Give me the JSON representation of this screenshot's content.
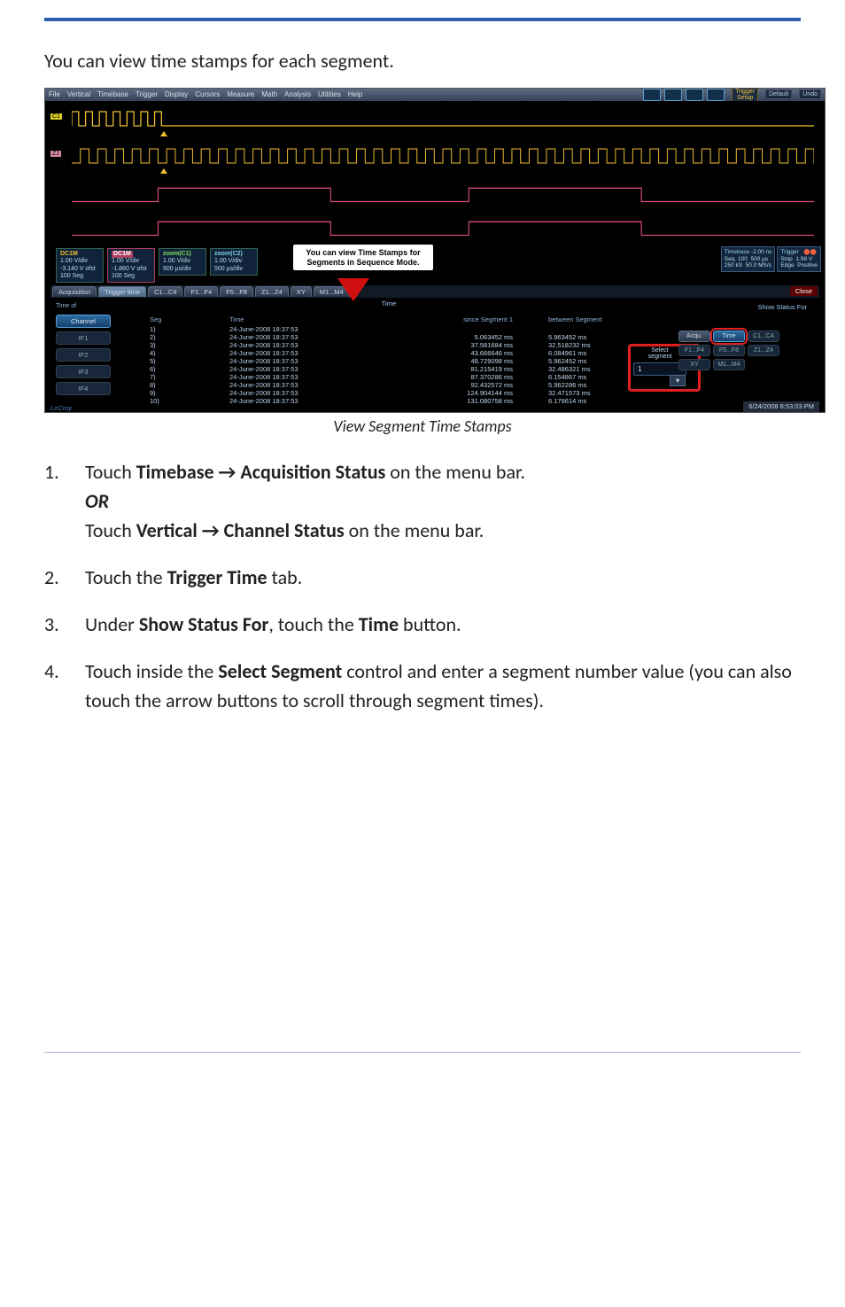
{
  "doc": {
    "intro": "You can view time stamps for each segment.",
    "caption": "View Segment Time Stamps",
    "steps": {
      "s1a_pre": "Touch ",
      "s1a_bold": "Timebase → Acquisition Status",
      "s1a_post": " on the menu bar.",
      "or": "OR",
      "s1b_pre": "Touch ",
      "s1b_bold": "Vertical → Channel Status",
      "s1b_post": " on the menu bar.",
      "s2_pre": "Touch the ",
      "s2_bold": "Trigger Time",
      "s2_post": " tab.",
      "s3_pre": "Under ",
      "s3_bold1": "Show Status For",
      "s3_mid": ", touch the ",
      "s3_bold2": "Time",
      "s3_post": " button.",
      "s4_pre": "Touch inside the ",
      "s4_bold": "Select Segment",
      "s4_post": " control and enter a segment number value (you can also touch the arrow buttons to scroll through segment times)."
    }
  },
  "menu": {
    "items": [
      "File",
      "Vertical",
      "Timebase",
      "Trigger",
      "Display",
      "Cursors",
      "Measure",
      "Math",
      "Analysis",
      "Utilities",
      "Help"
    ],
    "trigger_setup": "Trigger\nSetup",
    "default": "Default",
    "undo": "Undo"
  },
  "channels": {
    "c1": {
      "hdr": "DC1M",
      "l1": "1.00 V/div",
      "l2": "-3.140 V ofst",
      "l3": "100 Seg"
    },
    "c2": {
      "hdr": "DC1M",
      "l1": "1.00 V/div",
      "l2": "-1.880 V ofst",
      "l3": "100 Seg"
    },
    "z1": {
      "hdr": "zoom(C1)",
      "l1": "1.00 V/div",
      "l2": "500 µs/div"
    },
    "z2": {
      "hdr": "zoom(C2)",
      "l1": "1.00 V/div",
      "l2": "500 µs/div"
    }
  },
  "callout": "You can view Time Stamps for Segments in Sequence Mode.",
  "timebase": {
    "tb": {
      "a": "Timebase",
      "b": "-2.00 ns",
      "c": "Seq. 100",
      "d": "500 µs",
      "e": "250 kS",
      "f": "50.0 MS/s"
    },
    "trg": {
      "a": "Trigger",
      "b": "Stop",
      "c": "1.98 V",
      "d": "Edge",
      "e": "Positive"
    }
  },
  "tabs": {
    "acq": "Acquisition",
    "trig": "Trigger time",
    "c14": "C1...C4",
    "f14": "F1...F4",
    "f58": "F5...F8",
    "z14": "Z1...Z4",
    "xy": "XY",
    "m14": "M1...M4",
    "close": "Close"
  },
  "panel": {
    "title": "Time",
    "time_of": "Time of",
    "channel": "Channel",
    "if_labels": [
      "IF1",
      "IF2",
      "IF3",
      "IF4"
    ],
    "headers": {
      "seg": "Seg",
      "time": "Time",
      "since": "since Segment 1",
      "between": "between Segment"
    },
    "rows": [
      {
        "seg": "1)",
        "time": "24-June-2008 18:37:53",
        "since": "",
        "between": ""
      },
      {
        "seg": "2)",
        "time": "24-June-2008 18:37:53",
        "since": "5.063452 ms",
        "between": "5.963452 ms"
      },
      {
        "seg": "3)",
        "time": "24-June-2008 18:37:53",
        "since": "37.581684 ms",
        "between": "32.518232 ms"
      },
      {
        "seg": "4)",
        "time": "24-June-2008 18:37:53",
        "since": "43.666646 ms",
        "between": "6.084961 ms"
      },
      {
        "seg": "5)",
        "time": "24-June-2008 18:37:53",
        "since": "48.729098 ms",
        "between": "5.962452 ms"
      },
      {
        "seg": "6)",
        "time": "24-June-2008 18:37:53",
        "since": "81.215419 ms",
        "between": "32.486321 ms"
      },
      {
        "seg": "7)",
        "time": "24-June-2008 18:37:53",
        "since": "87.370286 ms",
        "between": "6.154867 ms"
      },
      {
        "seg": "8)",
        "time": "24-June-2008 18:37:53",
        "since": "92.432572 ms",
        "between": "5.962286 ms"
      },
      {
        "seg": "9)",
        "time": "24-June-2008 18:37:53",
        "since": "124.904144 ms",
        "between": "32.471573 ms"
      },
      {
        "seg": "10)",
        "time": "24-June-2008 18:37:53",
        "since": "131.080758 ms",
        "between": "6.176614 ms"
      }
    ],
    "show_status_for": "Show Status For",
    "buttons": {
      "acqu": "Acqu.",
      "time": "Time",
      "c1c4": "C1...C4",
      "f1f4": "F1...F4",
      "f5f8": "F5...F8",
      "z1z4": "Z1...Z4",
      "xy": "XY",
      "m1m4": "M1...M4"
    },
    "select_segment_label": "Select\nsegment",
    "select_segment_value": "1"
  },
  "footer": {
    "brand": "LeCroy",
    "timestamp": "6/24/2008 6:53:03 PM"
  }
}
